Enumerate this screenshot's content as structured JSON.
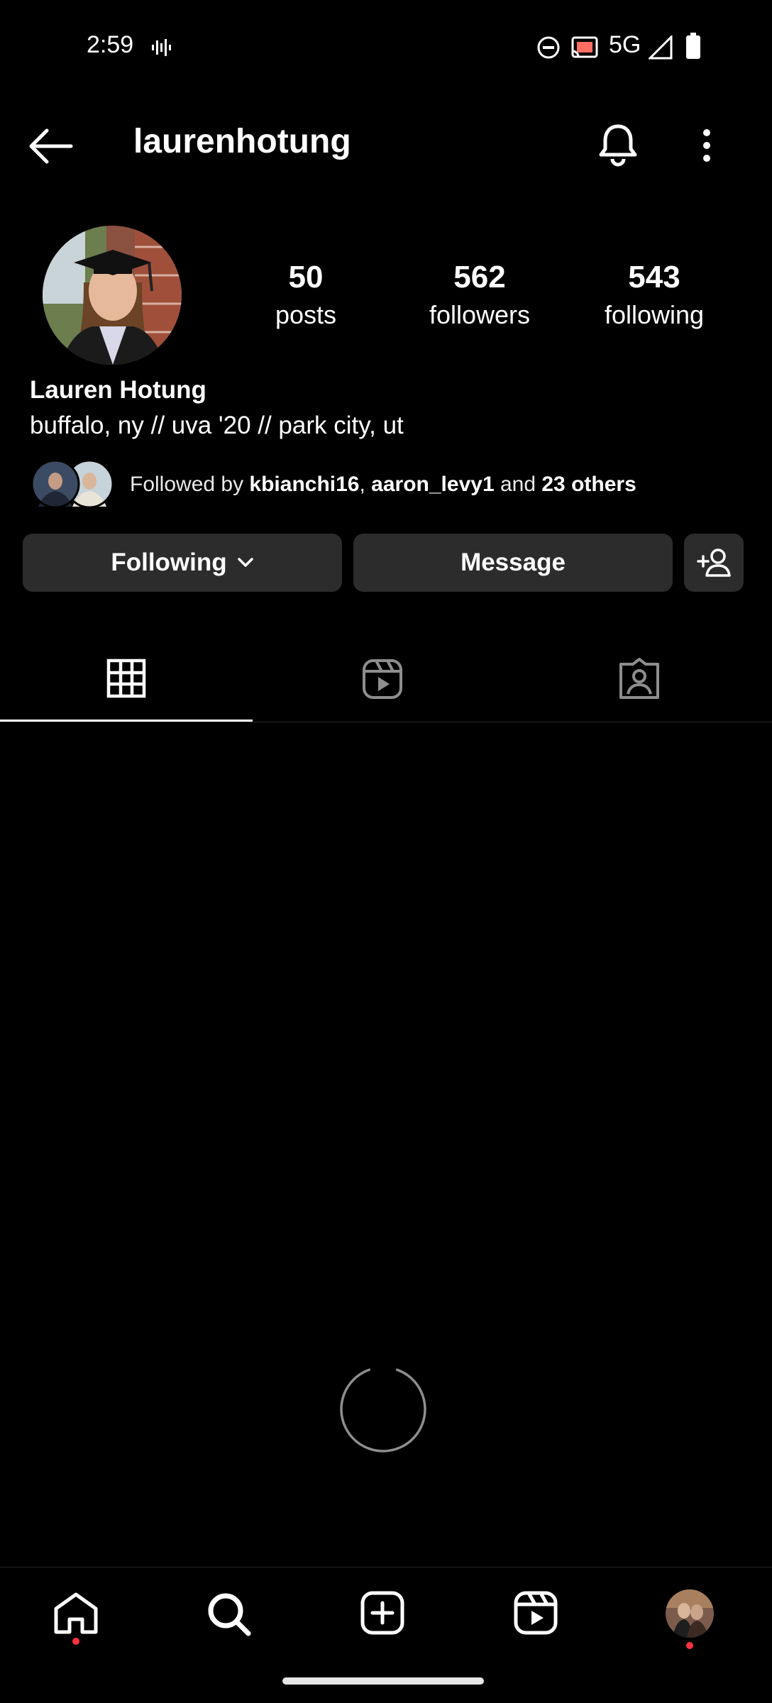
{
  "status_bar": {
    "time": "2:59",
    "network": "5G"
  },
  "header": {
    "username": "laurenhotung"
  },
  "profile": {
    "stats": [
      {
        "value": "50",
        "label": "posts"
      },
      {
        "value": "562",
        "label": "followers"
      },
      {
        "value": "543",
        "label": "following"
      }
    ],
    "full_name": "Lauren Hotung",
    "bio": "buffalo, ny // uva '20 // park city, ut",
    "followed_by": {
      "prefix": "Followed by ",
      "user1": "kbianchi16",
      "separator": ", ",
      "user2": "aaron_levy1",
      "middle": " and ",
      "others": "23 others"
    }
  },
  "actions": {
    "following_label": "Following",
    "message_label": "Message"
  },
  "tabs": [
    {
      "icon": "grid-icon",
      "active": true
    },
    {
      "icon": "reels-icon",
      "active": false
    },
    {
      "icon": "tagged-icon",
      "active": false
    }
  ],
  "bottom_nav": [
    "home-icon",
    "search-icon",
    "create-icon",
    "reels-icon",
    "profile-avatar"
  ],
  "colors": {
    "background": "#000000",
    "button": "#2c2c2c",
    "notification_dot": "#ff3040"
  }
}
